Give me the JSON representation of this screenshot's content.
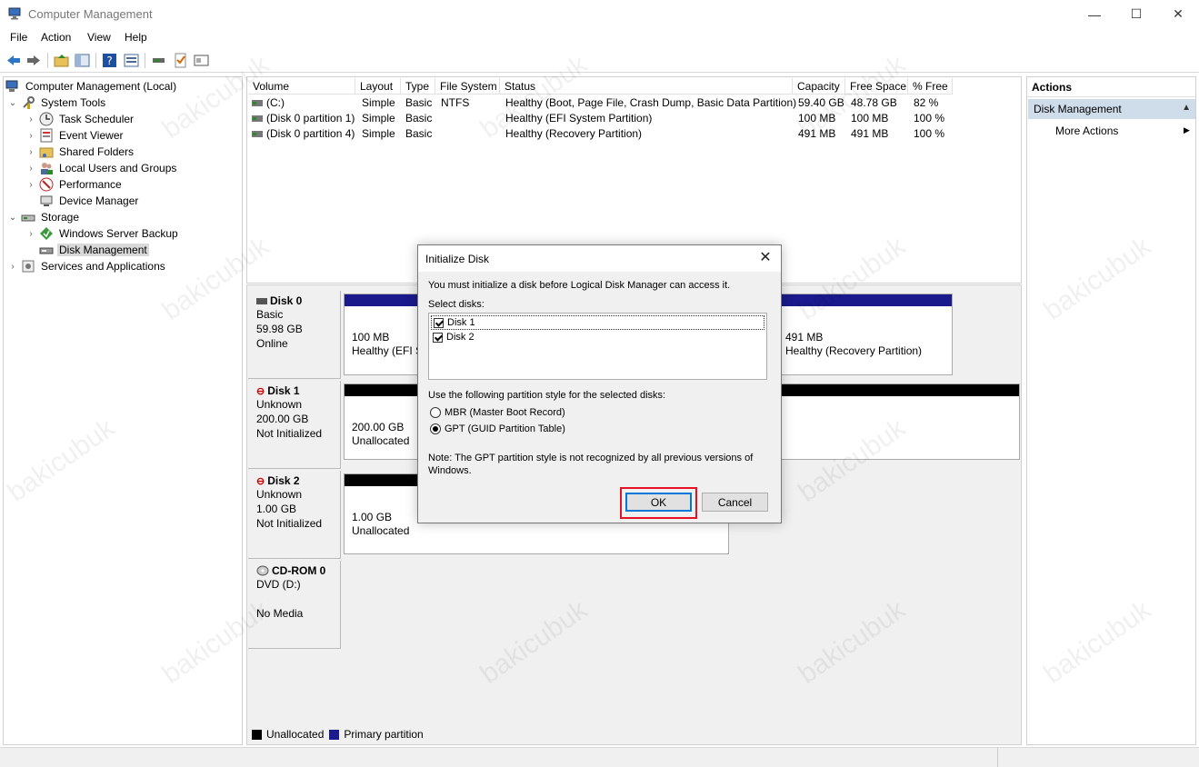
{
  "window": {
    "title": "Computer Management",
    "min": "—",
    "max": "☐",
    "close": "✕"
  },
  "menu": [
    "File",
    "Action",
    "View",
    "Help"
  ],
  "tree": [
    {
      "label": "Computer Management (Local)",
      "chev": ""
    },
    {
      "label": "System Tools",
      "chev": "⌄"
    },
    {
      "label": "Task Scheduler",
      "chev": "›"
    },
    {
      "label": "Event Viewer",
      "chev": "›"
    },
    {
      "label": "Shared Folders",
      "chev": "›"
    },
    {
      "label": "Local Users and Groups",
      "chev": "›"
    },
    {
      "label": "Performance",
      "chev": "›"
    },
    {
      "label": "Device Manager",
      "chev": ""
    },
    {
      "label": "Storage",
      "chev": "⌄"
    },
    {
      "label": "Windows Server Backup",
      "chev": "›"
    },
    {
      "label": "Disk Management",
      "chev": ""
    },
    {
      "label": "Services and Applications",
      "chev": "›"
    }
  ],
  "volumes": {
    "columns": [
      "Volume",
      "Layout",
      "Type",
      "File System",
      "Status",
      "Capacity",
      "Free Space",
      "% Free"
    ],
    "rows": [
      [
        "(C:)",
        "Simple",
        "Basic",
        "NTFS",
        "Healthy (Boot, Page File, Crash Dump, Basic Data Partition)",
        "59.40 GB",
        "48.78 GB",
        "82 %"
      ],
      [
        "(Disk 0 partition 1)",
        "Simple",
        "Basic",
        "",
        "Healthy (EFI System Partition)",
        "100 MB",
        "100 MB",
        "100 %"
      ],
      [
        "(Disk 0 partition 4)",
        "Simple",
        "Basic",
        "",
        "Healthy (Recovery Partition)",
        "491 MB",
        "491 MB",
        "100 %"
      ]
    ]
  },
  "disks": [
    {
      "name": "Disk 0",
      "lines": [
        "Basic",
        "59.98 GB",
        "Online"
      ],
      "parts": [
        [
          "100 MB",
          "Healthy (EFI Sy"
        ],
        [
          "491 MB",
          "Healthy (Recovery Partition)"
        ]
      ]
    },
    {
      "name": "Disk 1",
      "lines": [
        "Unknown",
        "200.00 GB",
        "Not Initialized"
      ],
      "parts": [
        [
          "200.00 GB",
          "Unallocated"
        ]
      ]
    },
    {
      "name": "Disk 2",
      "lines": [
        "Unknown",
        "1.00 GB",
        "Not Initialized"
      ],
      "parts": [
        [
          "1.00 GB",
          "Unallocated"
        ]
      ]
    },
    {
      "name": "CD-ROM 0",
      "lines": [
        "DVD (D:)",
        "",
        "No Media"
      ],
      "parts": []
    }
  ],
  "legend": {
    "unallocated": "Unallocated",
    "primary": "Primary partition"
  },
  "colors": {
    "primary": "#1a1a8c",
    "unallocated": "#000000",
    "selected_action": "#cfdcea",
    "highlight": "#e81123"
  },
  "actions": {
    "header": "Actions",
    "section": "Disk Management",
    "more": "More Actions",
    "section_arrow": "▲",
    "more_arrow": "▶"
  },
  "dialog": {
    "title": "Initialize Disk",
    "intro": "You must initialize a disk before Logical Disk Manager can access it.",
    "select_label": "Select disks:",
    "disks": [
      "Disk 1",
      "Disk 2"
    ],
    "style_label": "Use the following partition style for the selected disks:",
    "mbr": "MBR (Master Boot Record)",
    "gpt": "GPT (GUID Partition Table)",
    "note1": "Note: The GPT partition style is not recognized by all previous versions of",
    "note2": "Windows.",
    "ok": "OK",
    "cancel": "Cancel"
  },
  "watermark": "bakicubuk"
}
